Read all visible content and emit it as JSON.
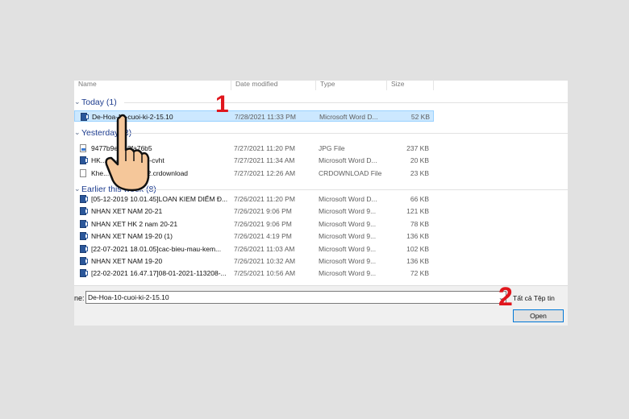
{
  "columns": {
    "name": "Name",
    "date": "Date modified",
    "type": "Type",
    "size": "Size"
  },
  "groups": [
    {
      "label": "Today (1)",
      "files": [
        {
          "name": "De-Hoa-10-cuoi-ki-2-15.10",
          "date": "7/28/2021 11:33 PM",
          "type": "Microsoft Word D...",
          "size": "52 KB",
          "icon": "word-icon",
          "selected": true
        }
      ]
    },
    {
      "label": "Yesterday (3)",
      "files": [
        {
          "name": "9477b9e8...2fa76b5",
          "date": "7/27/2021 11:20 PM",
          "type": "JPG File",
          "size": "237 KB",
          "icon": "image-file-icon"
        },
        {
          "name": "HK...gia-giang-vien-cvht",
          "date": "7/27/2021 11:34 AM",
          "type": "Microsoft Word D...",
          "size": "20 KB",
          "icon": "word-icon"
        },
        {
          "name": "Khe... nhận 899062.crdownload",
          "date": "7/27/2021 12:26 AM",
          "type": "CRDOWNLOAD File",
          "size": "23 KB",
          "icon": "blank-file-icon"
        }
      ]
    },
    {
      "label": "Earlier this week (8)",
      "files": [
        {
          "name": "[05-12-2019 10.01.45]LOAN KIEM DIỂM Đ...",
          "date": "7/26/2021 11:20 PM",
          "type": "Microsoft Word D...",
          "size": "66 KB",
          "icon": "word-icon"
        },
        {
          "name": "NHAN XET NAM 20-21",
          "date": "7/26/2021 9:06 PM",
          "type": "Microsoft Word 9...",
          "size": "121 KB",
          "icon": "word-icon"
        },
        {
          "name": "NHAN XET HK 2 nam 20-21",
          "date": "7/26/2021 9:06 PM",
          "type": "Microsoft Word 9...",
          "size": "78 KB",
          "icon": "word-icon"
        },
        {
          "name": "NHAN XET NAM 19-20 (1)",
          "date": "7/26/2021 4:19 PM",
          "type": "Microsoft Word 9...",
          "size": "136 KB",
          "icon": "word-icon"
        },
        {
          "name": "[22-07-2021 18.01.05]cac-bieu-mau-kem...",
          "date": "7/26/2021 11:03 AM",
          "type": "Microsoft Word 9...",
          "size": "102 KB",
          "icon": "word-icon"
        },
        {
          "name": "NHAN XET NAM 19-20",
          "date": "7/26/2021 10:32 AM",
          "type": "Microsoft Word 9...",
          "size": "136 KB",
          "icon": "word-icon"
        },
        {
          "name": "[22-02-2021 16.47.17]08-01-2021-113208-...",
          "date": "7/25/2021 10:56 AM",
          "type": "Microsoft Word 9...",
          "size": "72 KB",
          "icon": "word-icon"
        }
      ]
    }
  ],
  "file_name": {
    "label": "ne:",
    "value": "De-Hoa-10-cuoi-ki-2-15.10"
  },
  "file_type": "Tất cả Tệp tin",
  "open_button": "Open",
  "markers": {
    "step1": "1",
    "step2": "2"
  },
  "colors": {
    "group_header": "#1e3d8f",
    "selection": "#cce8ff",
    "marker": "#e0161d",
    "button_border": "#0078d7"
  }
}
